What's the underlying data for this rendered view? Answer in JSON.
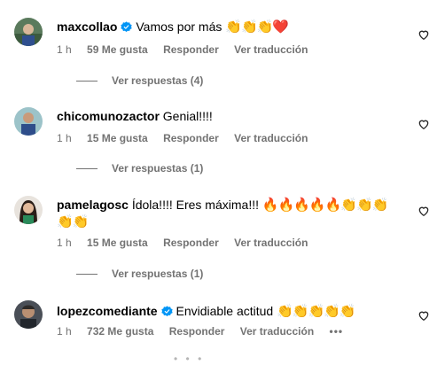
{
  "comments": [
    {
      "username": "maxcollao",
      "verified": true,
      "text": "Vamos por más",
      "emojis": "👏👏👏❤️",
      "time": "1 h",
      "likes": "59 Me gusta",
      "reply": "Responder",
      "translate": "Ver traducción",
      "view_replies": "Ver respuestas (4)"
    },
    {
      "username": "chicomunozactor",
      "verified": false,
      "text": "Genial!!!!",
      "time": "1 h",
      "likes": "15 Me gusta",
      "reply": "Responder",
      "translate": "Ver traducción",
      "view_replies": "Ver respuestas (1)"
    },
    {
      "username": "pamelagosc",
      "verified": false,
      "text": "Ídola!!!! Eres máxima!!!",
      "emojis_line1": "🔥🔥🔥🔥🔥👏👏👏",
      "emojis_line2": "👏👏",
      "time": "1 h",
      "likes": "15 Me gusta",
      "reply": "Responder",
      "translate": "Ver traducción",
      "view_replies": "Ver respuestas (1)"
    },
    {
      "username": "lopezcomediante",
      "verified": true,
      "text": "Envidiable actitud",
      "emojis": "👏👏👏👏👏",
      "time": "1 h",
      "likes": "732 Me gusta",
      "reply": "Responder",
      "translate": "Ver traducción",
      "more": "•••"
    }
  ],
  "icons": {
    "like": "heart-outline-icon",
    "verified": "verified-badge-icon",
    "verified_color": "#0095f6"
  }
}
